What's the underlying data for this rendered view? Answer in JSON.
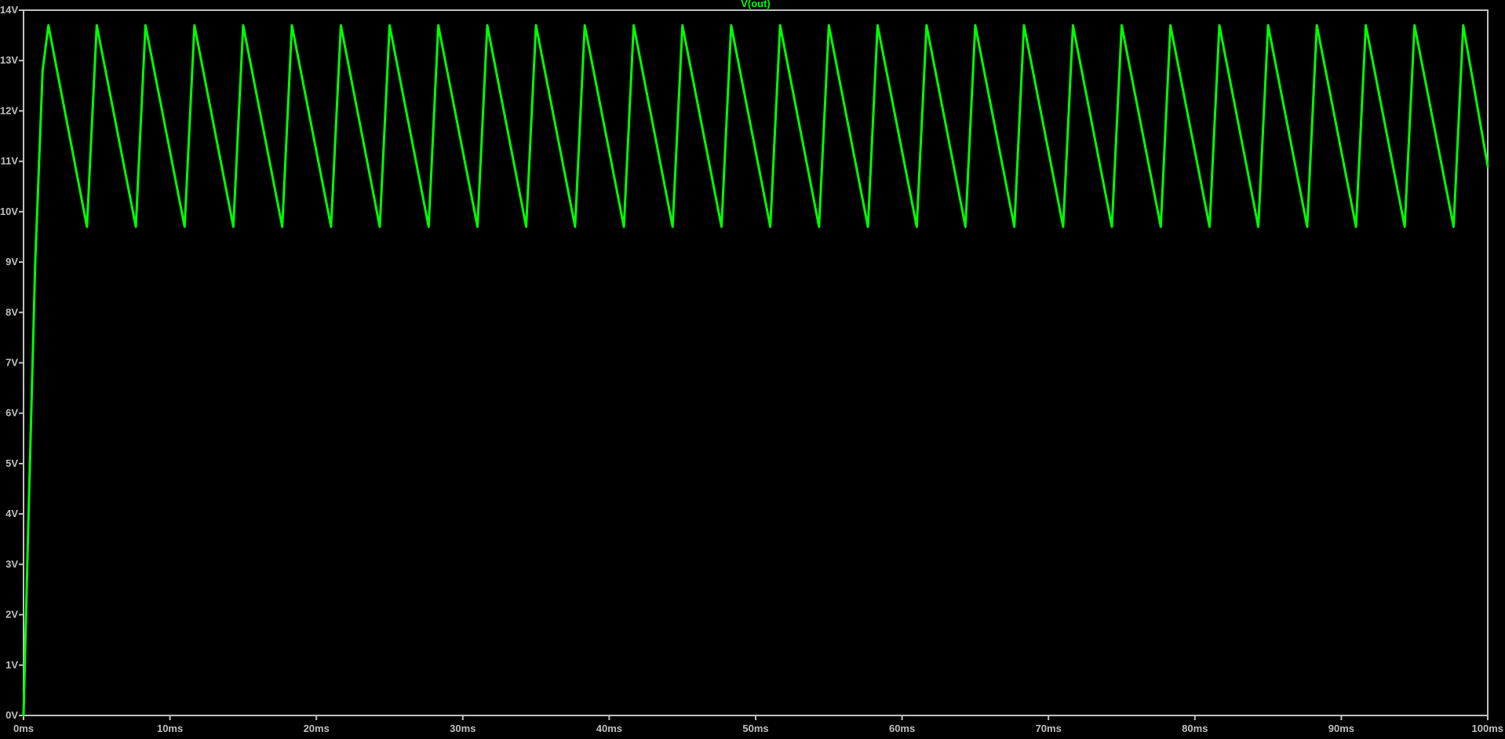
{
  "colors": {
    "background": "#000000",
    "frame": "#c0c0c0",
    "tick_label": "#c0c0c0",
    "trace": "#00ff00"
  },
  "chart_data": {
    "type": "line",
    "title": "V(out)",
    "xlabel": "",
    "ylabel": "",
    "xlim": [
      0,
      100
    ],
    "ylim": [
      0,
      14
    ],
    "x_ticks": [
      0,
      10,
      20,
      30,
      40,
      50,
      60,
      70,
      80,
      90,
      100
    ],
    "x_tick_labels": [
      "0ms",
      "10ms",
      "20ms",
      "30ms",
      "40ms",
      "50ms",
      "60ms",
      "70ms",
      "80ms",
      "90ms",
      "100ms"
    ],
    "y_ticks": [
      0,
      1,
      2,
      3,
      4,
      5,
      6,
      7,
      8,
      9,
      10,
      11,
      12,
      13,
      14
    ],
    "y_tick_labels": [
      "0V",
      "1V",
      "2V",
      "3V",
      "4V",
      "5V",
      "6V",
      "7V",
      "8V",
      "9V",
      "10V",
      "11V",
      "12V",
      "13V",
      "14V"
    ],
    "grid": false,
    "series": [
      {
        "name": "V(out)",
        "x": [
          0,
          0.3,
          0.8,
          1.3,
          1.7,
          4.33,
          5.0,
          7.67,
          8.33,
          11.0,
          11.67,
          14.33,
          15.0,
          17.67,
          18.33,
          21.0,
          21.67,
          24.33,
          25.0,
          27.67,
          28.33,
          31.0,
          31.67,
          34.33,
          35.0,
          37.67,
          38.33,
          41.0,
          41.67,
          44.33,
          45.0,
          47.67,
          48.33,
          51.0,
          51.67,
          54.33,
          55.0,
          57.67,
          58.33,
          61.0,
          61.67,
          64.33,
          65.0,
          67.67,
          68.33,
          71.0,
          71.67,
          74.33,
          75.0,
          77.67,
          78.33,
          81.0,
          81.67,
          84.33,
          85.0,
          87.67,
          88.33,
          91.0,
          91.67,
          94.33,
          95.0,
          97.67,
          98.33,
          100.0
        ],
        "y": [
          0,
          3.5,
          9.0,
          12.8,
          13.7,
          9.7,
          13.7,
          9.7,
          13.7,
          9.7,
          13.7,
          9.7,
          13.7,
          9.7,
          13.7,
          9.7,
          13.7,
          9.7,
          13.7,
          9.7,
          13.7,
          9.7,
          13.7,
          9.7,
          13.7,
          9.7,
          13.7,
          9.7,
          13.7,
          9.7,
          13.7,
          9.7,
          13.7,
          9.7,
          13.7,
          9.7,
          13.7,
          9.7,
          13.7,
          9.7,
          13.7,
          9.7,
          13.7,
          9.7,
          13.7,
          9.7,
          13.7,
          9.7,
          13.7,
          9.7,
          13.7,
          9.7,
          13.7,
          9.7,
          13.7,
          9.7,
          13.7,
          9.7,
          13.7,
          9.7,
          13.7,
          9.7,
          13.7,
          10.9
        ]
      }
    ]
  }
}
